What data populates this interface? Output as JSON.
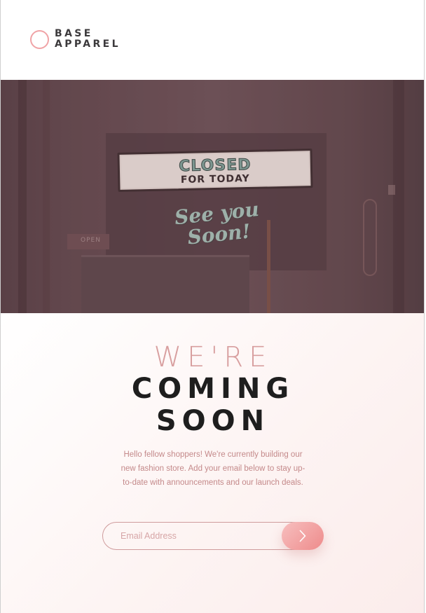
{
  "brand": {
    "line1": "BASE",
    "line2": "APPAREL",
    "accent_color": "#f0a3a6"
  },
  "hero": {
    "sign_line1": "CLOSED",
    "sign_line2": "FOR TODAY",
    "script_line1": "See you",
    "script_line2": "Soon!",
    "door_label": "OPEN"
  },
  "headline": {
    "light": "WE'RE",
    "dark1": "COMING",
    "dark2": "SOON"
  },
  "description": "Hello fellow shoppers! We're currently building our new fashion store. Add your email below to stay up-to-date with announcements and our launch deals.",
  "signup": {
    "email_placeholder": "Email Address",
    "email_value": "",
    "submit_icon": "chevron-right-icon"
  },
  "colors": {
    "pink_text": "#c4898a",
    "heading_dark": "#1e1e1e",
    "heading_light": "#d89f9f",
    "button_start": "#f7bfbf",
    "button_end": "#ee8b8b"
  }
}
